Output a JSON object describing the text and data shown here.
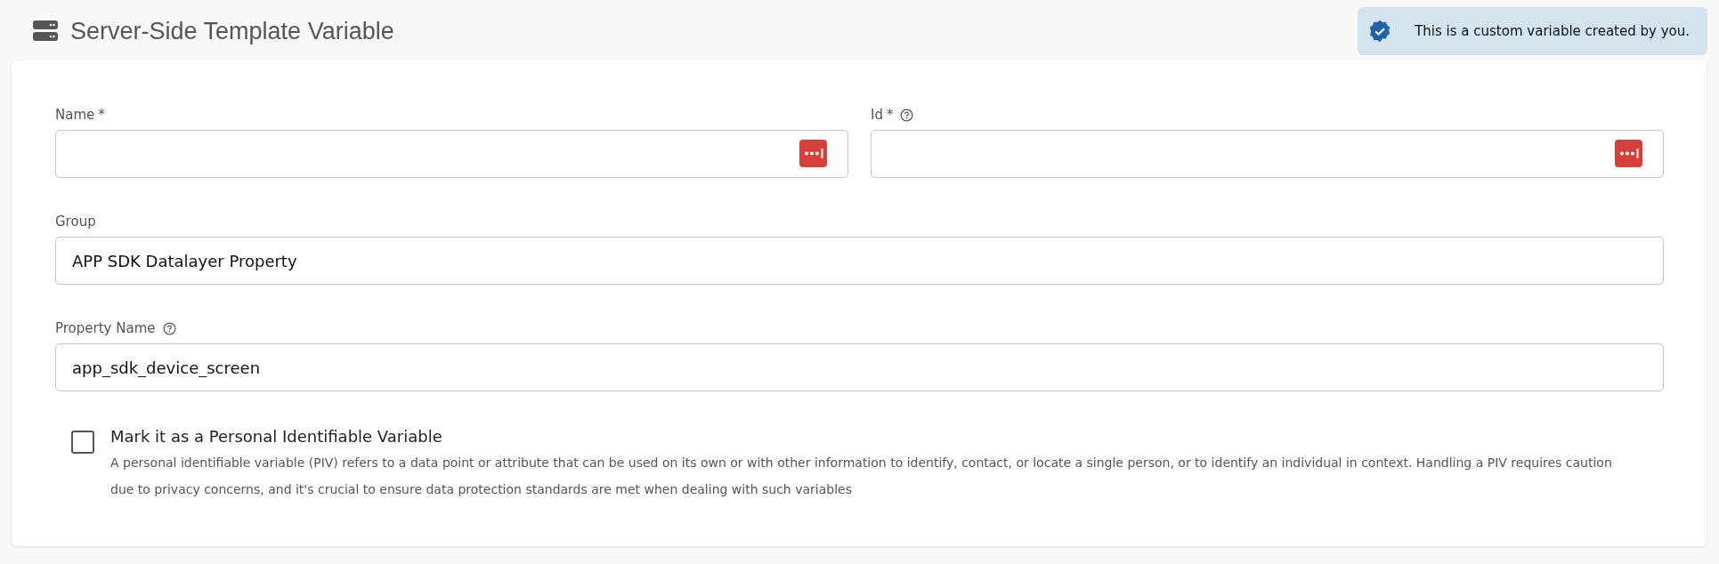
{
  "header": {
    "title": "Server-Side Template Variable"
  },
  "notice": {
    "text": "This is a custom variable created by you."
  },
  "field_rows": [
    [
      {
        "label": "Name",
        "required_mark": "*",
        "help": false,
        "password_icon": true
      },
      {
        "label": "Id",
        "required_mark": "*",
        "help": true,
        "password_icon": true
      }
    ],
    [
      {
        "label": "Group",
        "help": false,
        "value": "APP SDK Datalayer Property",
        "password_icon": false
      }
    ],
    [
      {
        "label": "Property Name",
        "help": true,
        "value": "app_sdk_device_screen",
        "password_icon": false
      }
    ]
  ],
  "piv": {
    "checked": false,
    "label": "Mark it as a Personal Identifiable Variable",
    "description": "A personal identifiable variable (PIV) refers to a data point or attribute that can be used on its own or with other information to identify, contact, or locate a single person, or to identify an individual in context. Handling a PIV requires caution due to privacy concerns, and it's crucial to ensure data protection standards are met when dealing with such variables"
  }
}
